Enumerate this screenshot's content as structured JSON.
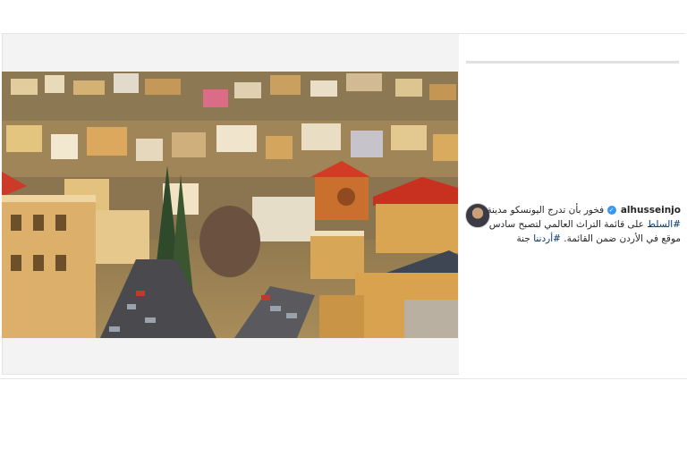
{
  "post": {
    "image_alt": "",
    "author": {
      "username": "alhusseinjo",
      "verified": true
    },
    "caption": {
      "line1_text": "فخور بأن تدرج اليونسكو مدينة",
      "line2_hashtag": "#السلط",
      "line2_text": " على قائمة التراث العالمي لتصبح سادس",
      "line3_text": "موقع في الأردن ضمن القائمة.",
      "line3_hashtag": " #أردننا",
      "line3_tail": " جنة"
    }
  },
  "colors": {
    "hashtag": "#003569",
    "verified_badge": "#3897f0",
    "card_bg": "#f3f3f3"
  },
  "icons": {
    "verified": "verified-badge-icon"
  }
}
